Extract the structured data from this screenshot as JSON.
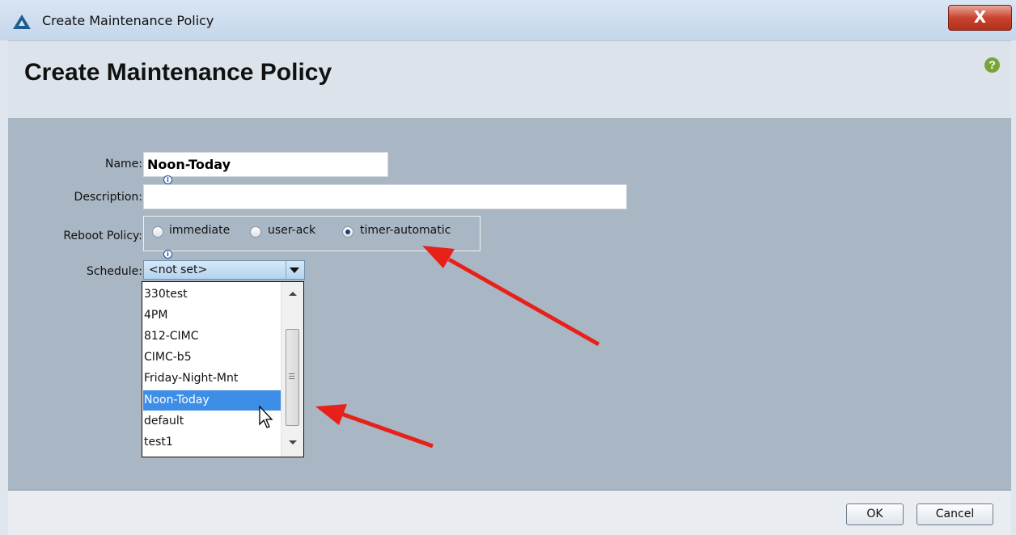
{
  "window": {
    "title": "Create Maintenance Policy",
    "close_label": "X"
  },
  "dialog": {
    "title": "Create Maintenance Policy",
    "help_label": "?"
  },
  "form": {
    "name": {
      "label": "Name:",
      "value": "Noon-Today"
    },
    "description": {
      "label": "Description:",
      "value": ""
    },
    "reboot_policy": {
      "label": "Reboot Policy:",
      "options": [
        "immediate",
        "user-ack",
        "timer-automatic"
      ],
      "selected": "timer-automatic"
    },
    "schedule": {
      "label": "Schedule:",
      "value": "<not set>",
      "options": [
        "330test",
        "4PM",
        "812-CIMC",
        "CIMC-b5",
        "Friday-Night-Mnt",
        "Noon-Today",
        "default",
        "test1"
      ],
      "highlighted": "Noon-Today"
    }
  },
  "buttons": {
    "ok": "OK",
    "cancel": "Cancel"
  },
  "colors": {
    "annotation_arrow": "#e8201a",
    "selection": "#3d8ee6"
  }
}
